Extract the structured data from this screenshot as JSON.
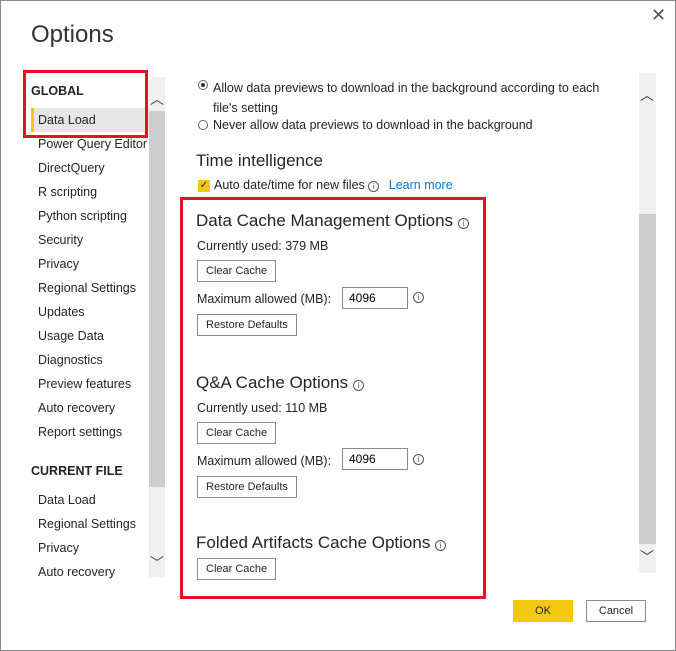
{
  "dialog": {
    "title": "Options",
    "close_icon": "close-icon"
  },
  "sidebar": {
    "global_header": "GLOBAL",
    "global_items": [
      "Data Load",
      "Power Query Editor",
      "DirectQuery",
      "R scripting",
      "Python scripting",
      "Security",
      "Privacy",
      "Regional Settings",
      "Updates",
      "Usage Data",
      "Diagnostics",
      "Preview features",
      "Auto recovery",
      "Report settings"
    ],
    "current_header": "CURRENT FILE",
    "current_items": [
      "Data Load",
      "Regional Settings",
      "Privacy",
      "Auto recovery"
    ],
    "selected": "Data Load"
  },
  "main": {
    "radio_allow": "Allow data previews to download in the background according to each file's setting",
    "radio_allow_line1": "Allow data previews to download in the background according to each",
    "radio_allow_line2": "file's setting",
    "radio_never": "Never allow data previews to download in the background",
    "time_intel": {
      "title": "Time intelligence",
      "checkbox": "Auto date/time for new files",
      "checked": true,
      "learn_more": "Learn more"
    },
    "data_cache": {
      "title": "Data Cache Management Options",
      "used": "Currently used: 379 MB",
      "clear": "Clear Cache",
      "max_label": "Maximum allowed (MB):",
      "max_value": "4096",
      "restore": "Restore Defaults"
    },
    "qa_cache": {
      "title": "Q&A Cache Options",
      "used": "Currently used: 110 MB",
      "clear": "Clear Cache",
      "max_label": "Maximum allowed (MB):",
      "max_value": "4096",
      "restore": "Restore Defaults"
    },
    "folded": {
      "title": "Folded Artifacts Cache Options",
      "clear": "Clear Cache"
    }
  },
  "footer": {
    "ok": "OK",
    "cancel": "Cancel"
  },
  "colors": {
    "accent": "#f2c811",
    "highlight": "#e81123",
    "link": "#0078d4"
  }
}
